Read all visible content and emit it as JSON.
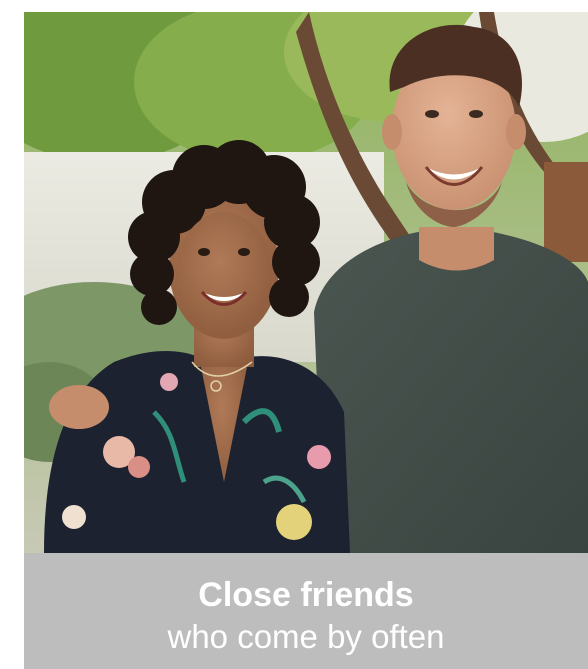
{
  "card": {
    "title": "Close friends",
    "subtitle": "who come by often"
  }
}
